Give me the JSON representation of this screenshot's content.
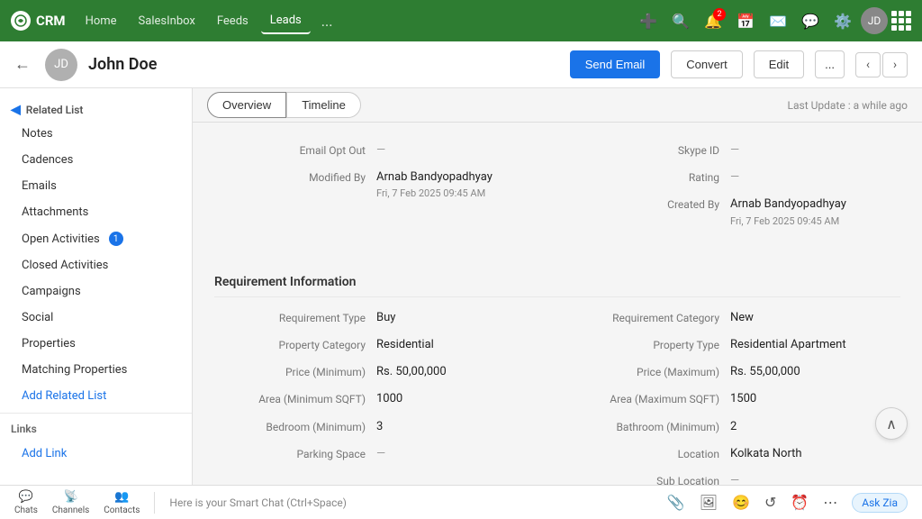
{
  "topNav": {
    "logo": "CRM",
    "items": [
      {
        "label": "Home",
        "active": false
      },
      {
        "label": "SalesInbox",
        "active": false
      },
      {
        "label": "Feeds",
        "active": false
      },
      {
        "label": "Leads",
        "active": true
      }
    ],
    "moreLabel": "...",
    "notificationBadge": "2"
  },
  "subHeader": {
    "title": "John Doe",
    "sendEmailLabel": "Send Email",
    "convertLabel": "Convert",
    "editLabel": "Edit",
    "moreLabel": "..."
  },
  "tabs": {
    "overview": "Overview",
    "timeline": "Timeline",
    "lastUpdate": "Last Update : a while ago"
  },
  "sidebar": {
    "relatedListHeader": "Related List",
    "items": [
      {
        "label": "Notes",
        "badge": null
      },
      {
        "label": "Cadences",
        "badge": null
      },
      {
        "label": "Emails",
        "badge": null
      },
      {
        "label": "Attachments",
        "badge": null
      },
      {
        "label": "Open Activities",
        "badge": "1"
      },
      {
        "label": "Closed Activities",
        "badge": null
      },
      {
        "label": "Campaigns",
        "badge": null
      },
      {
        "label": "Social",
        "badge": null
      },
      {
        "label": "Properties",
        "badge": null
      },
      {
        "label": "Matching Properties",
        "badge": null
      }
    ],
    "addRelatedList": "Add Related List",
    "linksHeader": "Links",
    "addLink": "Add Link"
  },
  "fields": {
    "emailOptOut": {
      "label": "Email Opt Out",
      "value": "—"
    },
    "modifiedBy": {
      "label": "Modified By",
      "value": "Arnab Bandyopadhyay",
      "sub": "Fri, 7 Feb 2025 09:45 AM"
    },
    "skypeId": {
      "label": "Skype ID",
      "value": "—"
    },
    "rating": {
      "label": "Rating",
      "value": "—"
    },
    "createdBy": {
      "label": "Created By",
      "value": "Arnab Bandyopadhyay",
      "sub": "Fri, 7 Feb 2025 09:45 AM"
    }
  },
  "requirementSection": {
    "title": "Requirement Information",
    "leftFields": [
      {
        "label": "Requirement Type",
        "value": "Buy"
      },
      {
        "label": "Property Category",
        "value": "Residential"
      },
      {
        "label": "Price (Minimum)",
        "value": "Rs. 50,00,000"
      },
      {
        "label": "Area (Minimum SQFT)",
        "value": "1000"
      },
      {
        "label": "Bedroom (Minimum)",
        "value": "3"
      },
      {
        "label": "Parking Space",
        "value": "—",
        "dash": true
      }
    ],
    "rightFields": [
      {
        "label": "Requirement Category",
        "value": "New"
      },
      {
        "label": "Property Type",
        "value": "Residential Apartment"
      },
      {
        "label": "Price (Maximum)",
        "value": "Rs. 55,00,000"
      },
      {
        "label": "Area (Maximum SQFT)",
        "value": "1500"
      },
      {
        "label": "Bathroom (Minimum)",
        "value": "2"
      },
      {
        "label": "Location",
        "value": "Kolkata North"
      },
      {
        "label": "Sub Location",
        "value": "—",
        "dash": true
      }
    ]
  },
  "bottomBar": {
    "chatLabel": "Chats",
    "channelsLabel": "Channels",
    "contactsLabel": "Contacts",
    "smartChat": "Here is your Smart Chat (Ctrl+Space)",
    "askZia": "Ask Zia"
  }
}
